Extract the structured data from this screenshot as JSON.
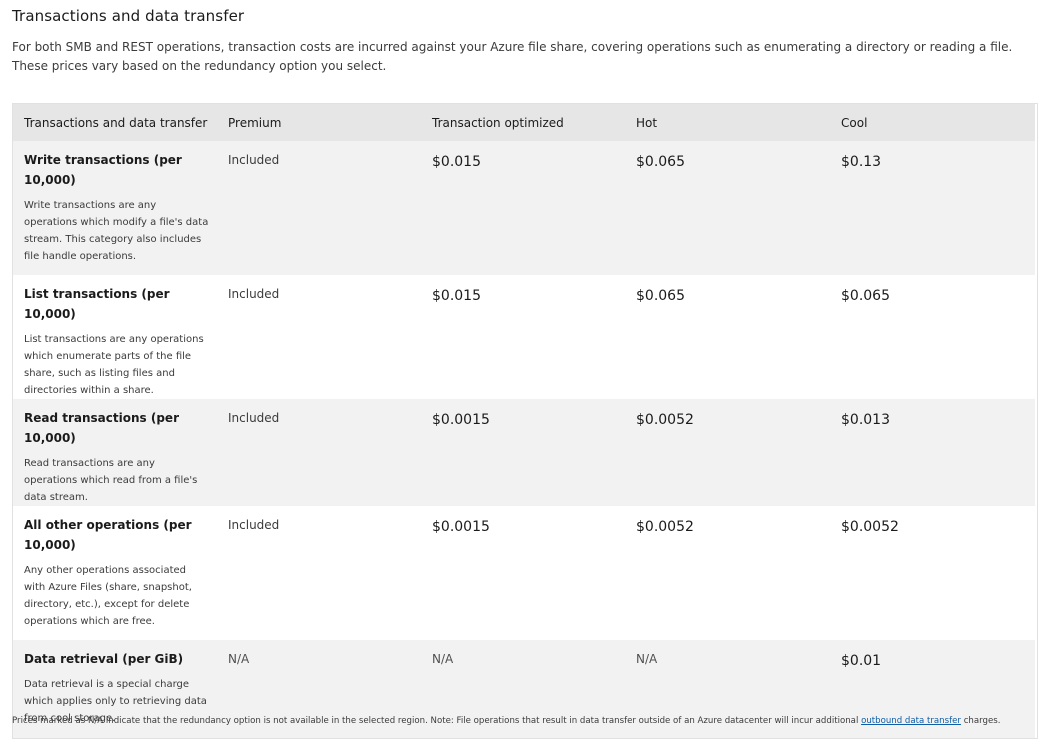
{
  "section": {
    "title": "Transactions and data transfer",
    "intro": "For both SMB and REST operations, transaction costs are incurred against your Azure file share, covering operations such as enumerating a directory or reading a file. These prices vary based on the redundancy option you select."
  },
  "table": {
    "headers": [
      "Transactions and data transfer",
      "Premium",
      "Transaction optimized",
      "Hot",
      "Cool"
    ],
    "rows": [
      {
        "name": "Write transactions (per 10,000)",
        "description": "Write transactions are any operations which modify a file's data stream. This category also includes file handle operations.",
        "premium": "Included",
        "transaction_optimized": "$0.015",
        "hot": "$0.065",
        "cool": "$0.13"
      },
      {
        "name": "List transactions (per 10,000)",
        "description": "List transactions are any operations which enumerate parts of the file share, such as listing files and directories within a share.",
        "premium": "Included",
        "transaction_optimized": "$0.015",
        "hot": "$0.065",
        "cool": "$0.065"
      },
      {
        "name": "Read transactions (per 10,000)",
        "description": "Read transactions are any operations which read from a file's data stream.",
        "premium": "Included",
        "transaction_optimized": "$0.0015",
        "hot": "$0.0052",
        "cool": "$0.013"
      },
      {
        "name": "All other operations (per 10,000)",
        "description": "Any other operations associated with Azure Files (share, snapshot, directory, etc.), except for delete operations which are free.",
        "premium": "Included",
        "transaction_optimized": "$0.0015",
        "hot": "$0.0052",
        "cool": "$0.0052"
      },
      {
        "name": "Data retrieval (per GiB)",
        "description": "Data retrieval is a special charge which applies only to retrieving data from cool storage.",
        "premium": "N/A",
        "transaction_optimized": "N/A",
        "hot": "N/A",
        "cool": "$0.01"
      }
    ]
  },
  "footnote": {
    "text_before": "Prices marked as N/A indicate that the redundancy option is not available in the selected region. Note: File operations that result in data transfer outside of an Azure datacenter will incur additional ",
    "link_text": "outbound data transfer",
    "text_after": " charges."
  }
}
